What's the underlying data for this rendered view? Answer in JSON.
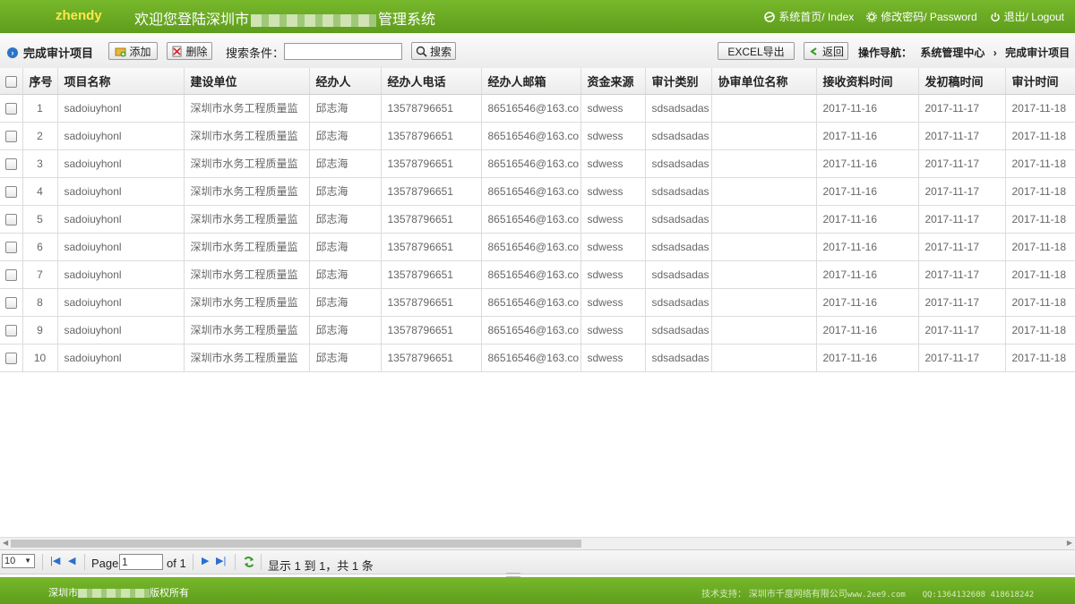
{
  "header": {
    "logo": "zhendy",
    "welcome_prefix": "欢迎您登陆深圳市",
    "welcome_suffix": "管理系统",
    "links": [
      {
        "label": "系统首页/ Index",
        "icon": "home-icon"
      },
      {
        "label": "修改密码/ Password",
        "icon": "gear-icon"
      },
      {
        "label": "退出/ Logout",
        "icon": "power-icon"
      }
    ]
  },
  "toolbar": {
    "title": "完成审计项目",
    "add_label": "添加",
    "delete_label": "删除",
    "search_label": "搜索条件：",
    "search_value": "",
    "search_button": "搜索",
    "export_label": "EXCEL导出",
    "back_label": "返回",
    "nav_label": "操作导航：",
    "nav_path": [
      "系统管理中心",
      "完成审计项目"
    ]
  },
  "table": {
    "columns": [
      "序号",
      "项目名称",
      "建设单位",
      "经办人",
      "经办人电话",
      "经办人邮箱",
      "资金来源",
      "审计类别",
      "协审单位名称",
      "接收资料时间",
      "发初稿时间",
      "审计时间"
    ],
    "rows": [
      [
        "1",
        "sadoiuyhonl",
        "深圳市水务工程质量监",
        "邱志海",
        "13578796651",
        "86516546@163.co",
        "sdwess",
        "sdsadsadas",
        "",
        "2017-11-16",
        "2017-11-17",
        "2017-11-18"
      ],
      [
        "2",
        "sadoiuyhonl",
        "深圳市水务工程质量监",
        "邱志海",
        "13578796651",
        "86516546@163.co",
        "sdwess",
        "sdsadsadas",
        "",
        "2017-11-16",
        "2017-11-17",
        "2017-11-18"
      ],
      [
        "3",
        "sadoiuyhonl",
        "深圳市水务工程质量监",
        "邱志海",
        "13578796651",
        "86516546@163.co",
        "sdwess",
        "sdsadsadas",
        "",
        "2017-11-16",
        "2017-11-17",
        "2017-11-18"
      ],
      [
        "4",
        "sadoiuyhonl",
        "深圳市水务工程质量监",
        "邱志海",
        "13578796651",
        "86516546@163.co",
        "sdwess",
        "sdsadsadas",
        "",
        "2017-11-16",
        "2017-11-17",
        "2017-11-18"
      ],
      [
        "5",
        "sadoiuyhonl",
        "深圳市水务工程质量监",
        "邱志海",
        "13578796651",
        "86516546@163.co",
        "sdwess",
        "sdsadsadas",
        "",
        "2017-11-16",
        "2017-11-17",
        "2017-11-18"
      ],
      [
        "6",
        "sadoiuyhonl",
        "深圳市水务工程质量监",
        "邱志海",
        "13578796651",
        "86516546@163.co",
        "sdwess",
        "sdsadsadas",
        "",
        "2017-11-16",
        "2017-11-17",
        "2017-11-18"
      ],
      [
        "7",
        "sadoiuyhonl",
        "深圳市水务工程质量监",
        "邱志海",
        "13578796651",
        "86516546@163.co",
        "sdwess",
        "sdsadsadas",
        "",
        "2017-11-16",
        "2017-11-17",
        "2017-11-18"
      ],
      [
        "8",
        "sadoiuyhonl",
        "深圳市水务工程质量监",
        "邱志海",
        "13578796651",
        "86516546@163.co",
        "sdwess",
        "sdsadsadas",
        "",
        "2017-11-16",
        "2017-11-17",
        "2017-11-18"
      ],
      [
        "9",
        "sadoiuyhonl",
        "深圳市水务工程质量监",
        "邱志海",
        "13578796651",
        "86516546@163.co",
        "sdwess",
        "sdsadsadas",
        "",
        "2017-11-16",
        "2017-11-17",
        "2017-11-18"
      ],
      [
        "10",
        "sadoiuyhonl",
        "深圳市水务工程质量监",
        "邱志海",
        "13578796651",
        "86516546@163.co",
        "sdwess",
        "sdsadsadas",
        "",
        "2017-11-16",
        "2017-11-17",
        "2017-11-18"
      ]
    ]
  },
  "pager": {
    "page_size": "10",
    "page_label": "Page",
    "page_value": "1",
    "of_label": "of 1",
    "display_text": "显示 1 到 1，共 1 条"
  },
  "footer": {
    "copyright_prefix": "深圳市",
    "copyright_suffix": "版权所有",
    "support_label": "技术支持：",
    "support_company": "深圳市千度网络有限公司",
    "support_site": "www.2ee9.com",
    "support_qq": "QQ:1364132608 418618242"
  },
  "colors": {
    "header_green": "#6aab22",
    "logo_yellow": "#ffe84a",
    "link_blue": "#2a6fd0"
  }
}
